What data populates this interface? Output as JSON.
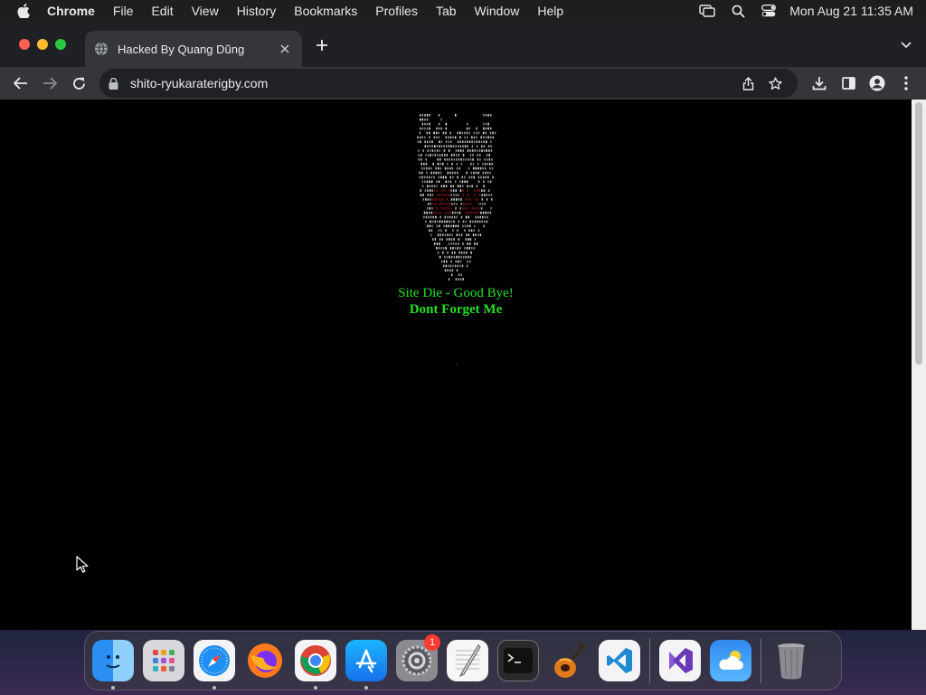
{
  "menubar": {
    "app_name": "Chrome",
    "items": [
      "File",
      "Edit",
      "View",
      "History",
      "Bookmarks",
      "Profiles",
      "Tab",
      "Window",
      "Help"
    ],
    "clock": "Mon Aug 21  11:35 AM"
  },
  "browser": {
    "tab_title": "Hacked By Quang Dũng",
    "url": "shito-ryukaraterigby.com"
  },
  "page": {
    "line1": "Site Die - Good Bye!",
    "line2": "Dont Forget Me",
    "text_color": "#22e024",
    "background": "#000000"
  },
  "dock": {
    "items": [
      "finder-icon",
      "launchpad-icon",
      "safari-icon",
      "firefox-icon",
      "chrome-icon",
      "app-store-icon",
      "system-settings-icon",
      "textedit-icon",
      "terminal-icon",
      "garageband-icon",
      "vscode-icon",
      "visual-studio-icon",
      "weather-icon",
      "trash-icon"
    ],
    "settings_badge": "1"
  }
}
